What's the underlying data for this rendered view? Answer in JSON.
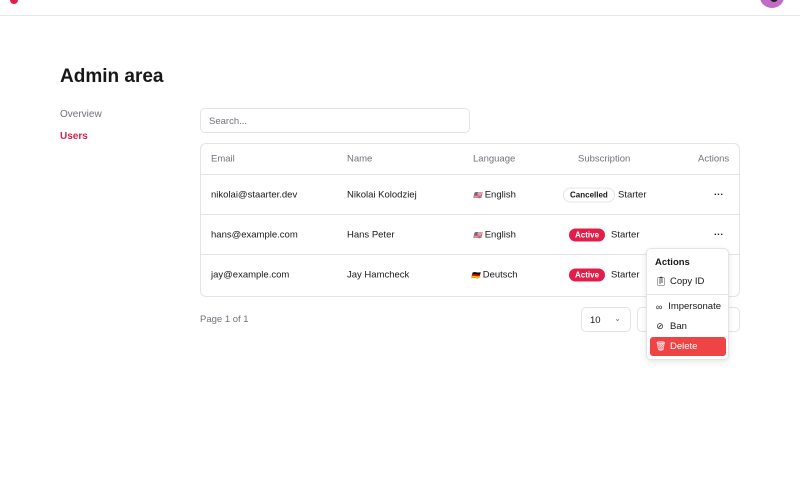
{
  "title": "Admin area",
  "sidebar": [
    {
      "label": "Overview"
    },
    {
      "label": "Users"
    }
  ],
  "search": {
    "placeholder": "Search..."
  },
  "columns": [
    "Email",
    "Name",
    "Language",
    "Subscription",
    "Actions"
  ],
  "rows": [
    {
      "email": "nikolai@staarter.dev",
      "name": "Nikolai Kolodziej",
      "flag": "🇺🇸",
      "language": "English",
      "status": "Cancelled",
      "plan": "Starter"
    },
    {
      "email": "hans@example.com",
      "name": "Hans Peter",
      "flag": "🇺🇸",
      "language": "English",
      "status": "Active",
      "plan": "Starter"
    },
    {
      "email": "jay@example.com",
      "name": "Jay Hamcheck",
      "flag": "🇩🇪",
      "language": "Deutsch",
      "status": "Active",
      "plan": "Starter"
    }
  ],
  "actions_glyph": "···",
  "pagination": {
    "page_text": "Page 1 of 1",
    "page_size": "10"
  },
  "menu": {
    "title": "Actions",
    "items": [
      {
        "label": "Copy ID"
      },
      {
        "label": "Impersonate"
      },
      {
        "label": "Ban"
      },
      {
        "label": "Delete"
      }
    ]
  },
  "colors": {
    "accent": "#e11d48",
    "danger": "#ef4444"
  }
}
